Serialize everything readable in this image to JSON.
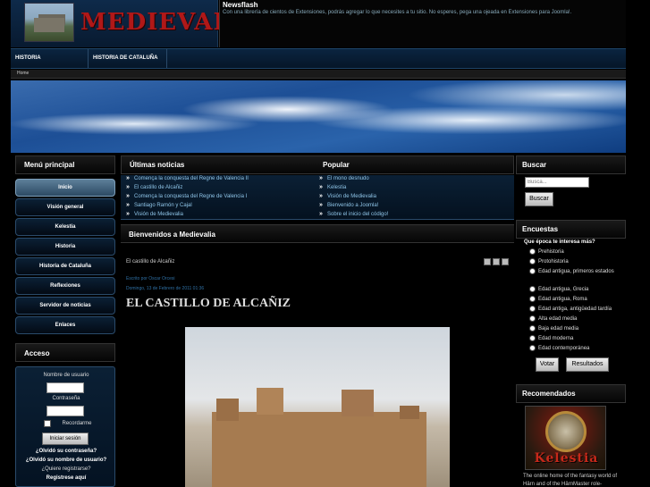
{
  "header": {
    "site_title": "MEDIEVALIA",
    "newsflash_title": "Newsflash",
    "newsflash_text": "Con una librería de cientos de Extensiones, podrás agregar lo que necesites a tu sitio. No esperes, pega una ojeada en Extensiones para Joomla!."
  },
  "nav": {
    "items": [
      "HISTORIA",
      "HISTORIA DE CATALUÑA"
    ],
    "breadcrumb": "Home"
  },
  "left": {
    "menu_title": "Menú principal",
    "menu": [
      "Inicio",
      "Visión general",
      "Kelestia",
      "Historia",
      "Historia de Cataluña",
      "Reflexiones",
      "Servidor de noticias",
      "Enlaces"
    ],
    "access_title": "Acceso",
    "username_label": "Nombre de usuario",
    "password_label": "Contraseña",
    "remember_label": "Recordarme",
    "login_button": "Iniciar sesión",
    "forgot_password": "¿Olvidó su contraseña?",
    "forgot_username": "¿Olvidó su nombre de usuario?",
    "register_q": "¿Quiere registrarse?",
    "register_link": "Registrese aquí"
  },
  "middle": {
    "latest_title": "Últimas noticias",
    "popular_title": "Popular",
    "latest": [
      "Comença la conquesta del Regne de Valencia II",
      "El castillo de Alcañiz",
      "Comença la conquesta del Regne de Valencia I",
      "Santiago Ramón y Cajal",
      "Visión de Medievalia"
    ],
    "popular": [
      "El mono desnudo",
      "Kelestia",
      "Visión de Medievalia",
      "Bienvenido a Joomla!",
      "Sobre el inicio del código!"
    ],
    "welcome_title": "Bienvenidos a Medievalia",
    "article_subtitle": "El castillo de Alcañiz",
    "author": "Escrito por Oscar Orcesi",
    "date": "Domingo, 13 de Febrero de 2011 01:36",
    "article_title": "EL CASTILLO DE ALCAÑIZ"
  },
  "right": {
    "search_title": "Buscar",
    "search_placeholder": "Busca...",
    "search_button": "Buscar",
    "poll_title": "Encuestas",
    "poll_question": "Que época te interesa más?",
    "poll_options": [
      "Prehistoria",
      "Protohistoria",
      "Edad antigua, primeros estados",
      "Edad antigua, Grecia",
      "Edad antigua, Roma",
      "Edad antiga, antigüedad tardía",
      "Alta edad media",
      "Baja edad media",
      "Edad moderna",
      "Edad contemporánea"
    ],
    "vote_button": "Votar",
    "results_button": "Resultados",
    "recommended_title": "Recomendados",
    "recommended_logo_text": "Kelestia",
    "recommended_text": "The online home of the fantasy world of Hârn and of the HârnMaster role-"
  },
  "colors": {
    "title_red": "#b01818",
    "link_blue": "#8fc5e8",
    "nav_blue": "#0a2440"
  }
}
